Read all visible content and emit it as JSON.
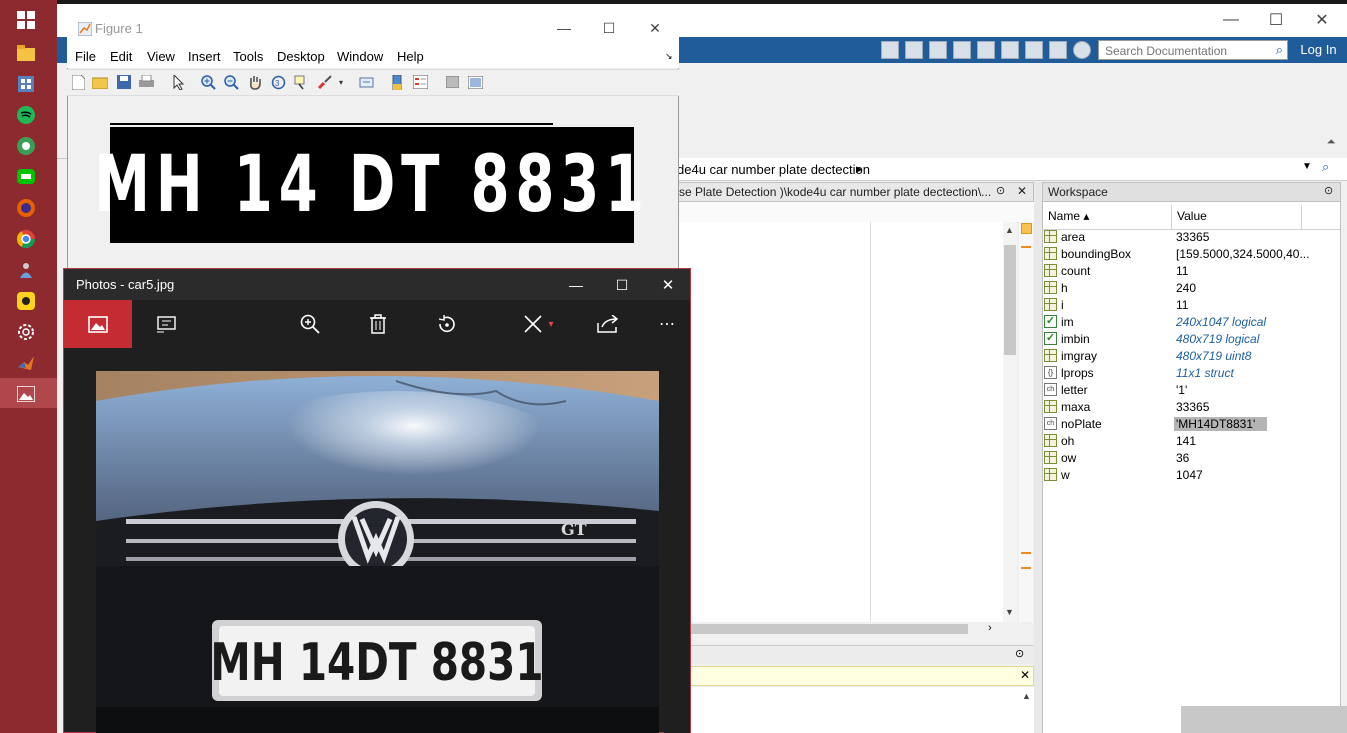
{
  "matlab": {
    "search_placeholder": "Search Documentation",
    "login": "Log In",
    "path": "de4u car number plate dectection",
    "editor_tab": "se Plate Detection )\\kode4u car number plate dectection\\...",
    "win_min": "—",
    "win_max": "☐",
    "win_close": "✕"
  },
  "workspace": {
    "title": "Workspace",
    "col_name": "Name ▴",
    "col_value": "Value",
    "rows": [
      {
        "name": "area",
        "value": "33365",
        "icon": "grid"
      },
      {
        "name": "boundingBox",
        "value": "[159.5000,324.5000,40...",
        "icon": "grid"
      },
      {
        "name": "count",
        "value": "11",
        "icon": "grid"
      },
      {
        "name": "h",
        "value": "240",
        "icon": "grid"
      },
      {
        "name": "i",
        "value": "11",
        "icon": "grid"
      },
      {
        "name": "im",
        "value": "240x1047 logical",
        "icon": "check"
      },
      {
        "name": "imbin",
        "value": "480x719 logical",
        "icon": "check"
      },
      {
        "name": "imgray",
        "value": "480x719 uint8",
        "icon": "grid"
      },
      {
        "name": "lprops",
        "value": "11x1 struct",
        "icon": "struct"
      },
      {
        "name": "letter",
        "value": "'1'",
        "icon": "char"
      },
      {
        "name": "maxa",
        "value": "33365",
        "icon": "grid"
      },
      {
        "name": "noPlate",
        "value": "'MH14DT8831'",
        "icon": "char"
      },
      {
        "name": "oh",
        "value": "141",
        "icon": "grid"
      },
      {
        "name": "ow",
        "value": "36",
        "icon": "grid"
      },
      {
        "name": "w",
        "value": "1047",
        "icon": "grid"
      }
    ]
  },
  "figure": {
    "title": "Figure 1",
    "menu": [
      "File",
      "Edit",
      "View",
      "Insert",
      "Tools",
      "Desktop",
      "Window",
      "Help"
    ],
    "plate_text": "MH 14 DT 8831"
  },
  "photos": {
    "title": "Photos - car5.jpg",
    "plate_text": "MH 14DT 8831",
    "badge_text": "GT"
  }
}
